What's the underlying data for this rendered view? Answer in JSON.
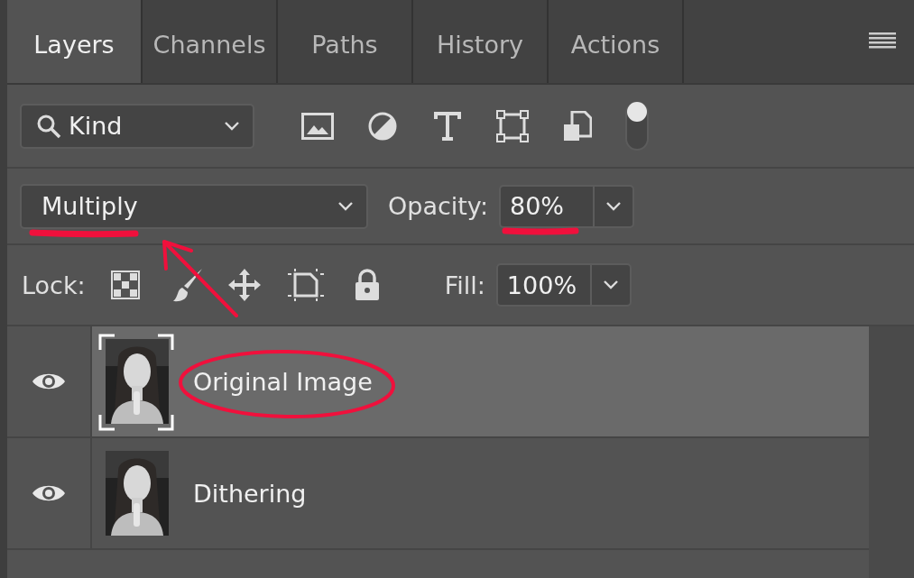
{
  "tabs": [
    {
      "label": "Layers",
      "selected": true
    },
    {
      "label": "Channels",
      "selected": false
    },
    {
      "label": "Paths",
      "selected": false
    },
    {
      "label": "History",
      "selected": false
    },
    {
      "label": "Actions",
      "selected": false
    }
  ],
  "filter": {
    "value": "Kind",
    "toggle_on": true
  },
  "blend_mode": {
    "value": "Multiply"
  },
  "opacity": {
    "label": "Opacity:",
    "value": "80%"
  },
  "lock": {
    "label": "Lock:"
  },
  "fill": {
    "label": "Fill:",
    "value": "100%"
  },
  "layers": [
    {
      "name": "Original Image",
      "visible": true,
      "selected": true
    },
    {
      "name": "Dithering",
      "visible": true,
      "selected": false
    }
  ]
}
